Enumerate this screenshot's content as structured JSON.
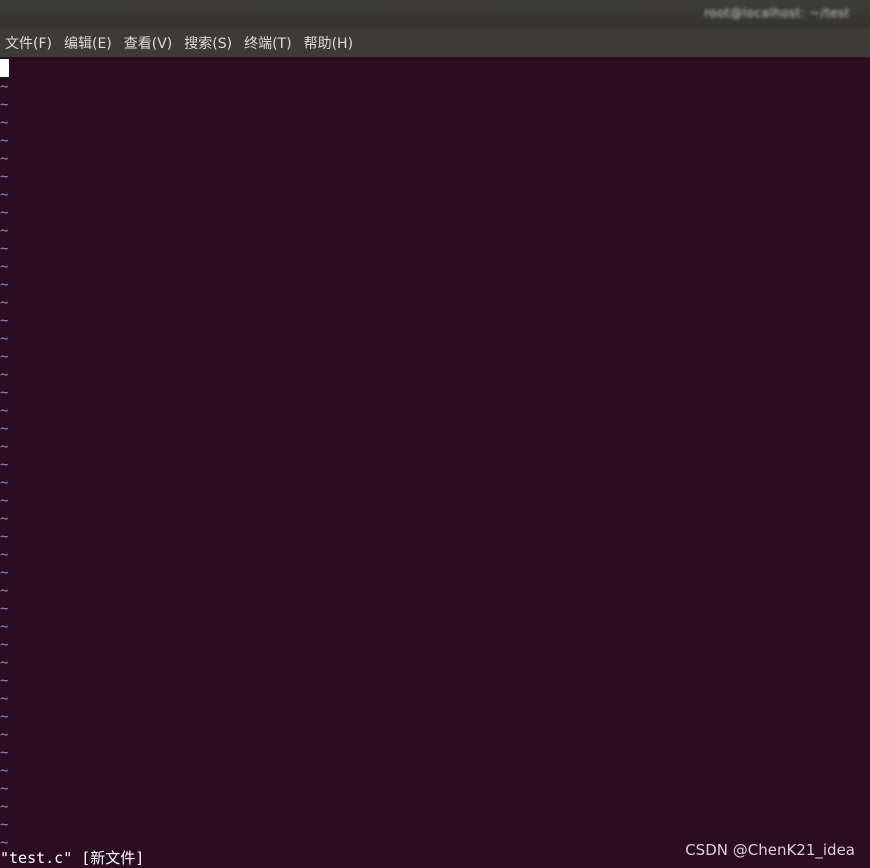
{
  "window": {
    "title": "root@localhost: ~/test"
  },
  "menubar": {
    "items": [
      {
        "label": "文件(F)"
      },
      {
        "label": "编辑(E)"
      },
      {
        "label": "查看(V)"
      },
      {
        "label": "搜索(S)"
      },
      {
        "label": "终端(T)"
      },
      {
        "label": "帮助(H)"
      }
    ]
  },
  "terminal": {
    "empty_line_marker": "~",
    "empty_line_count": 43,
    "status_line": "\"test.c\" [新文件]"
  },
  "watermark": {
    "text": "CSDN @ChenK21_idea"
  },
  "colors": {
    "background": "#2c0c21",
    "tilde": "#7f8bd0",
    "menubar": "#3c3b37"
  }
}
